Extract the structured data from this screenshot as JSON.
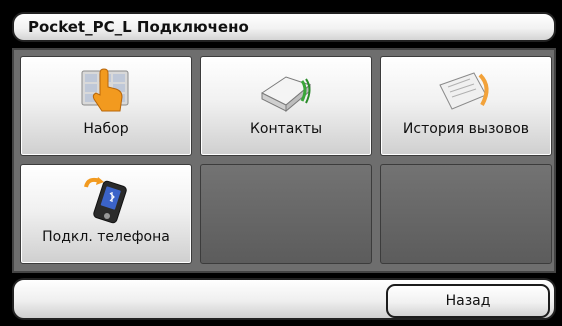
{
  "header": {
    "title": "Pocket_PC_L Подключено"
  },
  "tiles": [
    {
      "label": "Набор",
      "icon": "dial-hand-icon"
    },
    {
      "label": "Контакты",
      "icon": "contacts-book-icon"
    },
    {
      "label": "История вызовов",
      "icon": "call-history-icon"
    },
    {
      "label": "Подкл. телефона",
      "icon": "phone-connect-icon"
    }
  ],
  "footer": {
    "back_label": "Назад"
  }
}
